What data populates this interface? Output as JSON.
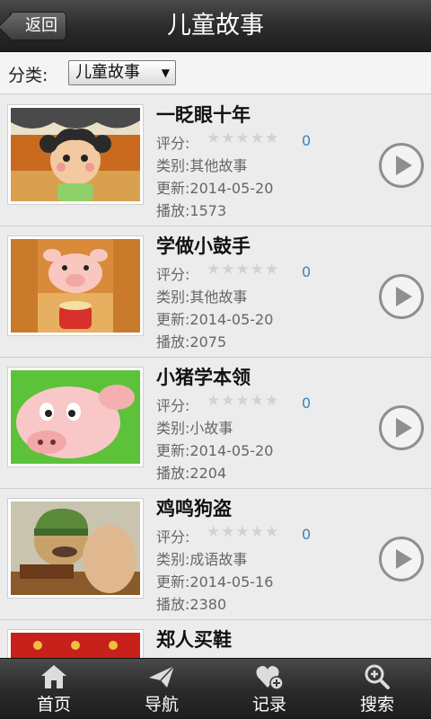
{
  "header": {
    "back_label": "返回",
    "title": "儿童故事"
  },
  "filter": {
    "label": "分类:",
    "selected": "儿童故事"
  },
  "labels": {
    "rating": "评分:",
    "category": "类别:",
    "updated": "更新:",
    "plays": "播放:"
  },
  "stories": [
    {
      "title": "一眨眼十年",
      "score": "0",
      "category": "其他故事",
      "updated": "2014-05-20",
      "plays": "1573"
    },
    {
      "title": "学做小鼓手",
      "score": "0",
      "category": "其他故事",
      "updated": "2014-05-20",
      "plays": "2075"
    },
    {
      "title": "小猪学本领",
      "score": "0",
      "category": "小故事",
      "updated": "2014-05-20",
      "plays": "2204"
    },
    {
      "title": "鸡鸣狗盗",
      "score": "0",
      "category": "成语故事",
      "updated": "2014-05-16",
      "plays": "2380"
    },
    {
      "title": "郑人买鞋"
    }
  ],
  "tabs": [
    {
      "label": "首页",
      "icon": "home-icon"
    },
    {
      "label": "导航",
      "icon": "paper-plane-icon"
    },
    {
      "label": "记录",
      "icon": "heart-plus-icon"
    },
    {
      "label": "搜索",
      "icon": "zoom-in-icon"
    }
  ],
  "colors": {
    "bar": "#2a2a2a",
    "score": "#3b83b8",
    "row_bg": "#ececec"
  }
}
